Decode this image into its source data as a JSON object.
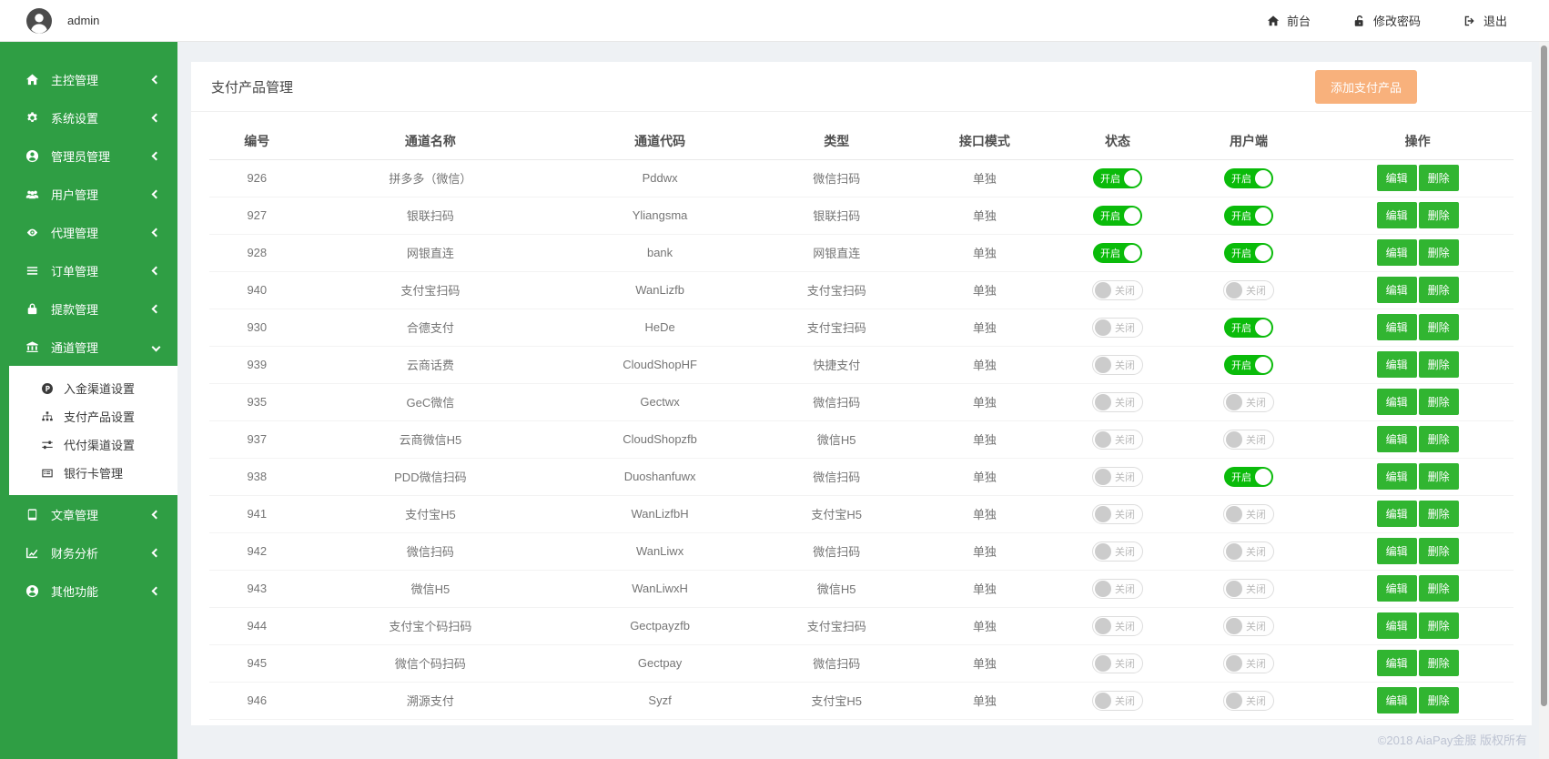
{
  "topbar": {
    "user": "admin",
    "nav": [
      {
        "icon": "home-icon",
        "label": "前台"
      },
      {
        "icon": "lock-open-icon",
        "label": "修改密码"
      },
      {
        "icon": "signout-icon",
        "label": "退出"
      }
    ]
  },
  "sidebar": {
    "items": [
      {
        "icon": "home-icon",
        "label": "主控管理",
        "expanded": false
      },
      {
        "icon": "gears-icon",
        "label": "系统设置",
        "expanded": false
      },
      {
        "icon": "user-circle-icon",
        "label": "管理员管理",
        "expanded": false
      },
      {
        "icon": "users-icon",
        "label": "用户管理",
        "expanded": false
      },
      {
        "icon": "eye-icon",
        "label": "代理管理",
        "expanded": false
      },
      {
        "icon": "list-icon",
        "label": "订单管理",
        "expanded": false
      },
      {
        "icon": "lock-icon",
        "label": "提款管理",
        "expanded": false
      },
      {
        "icon": "bank-icon",
        "label": "通道管理",
        "expanded": true,
        "children": [
          {
            "icon": "p-circle-icon",
            "label": "入金渠道设置"
          },
          {
            "icon": "sitemap-icon",
            "label": "支付产品设置"
          },
          {
            "icon": "sliders-icon",
            "label": "代付渠道设置"
          },
          {
            "icon": "list-alt-icon",
            "label": "银行卡管理"
          }
        ]
      },
      {
        "icon": "book-icon",
        "label": "文章管理",
        "expanded": false
      },
      {
        "icon": "chart-line-icon",
        "label": "财务分析",
        "expanded": false
      },
      {
        "icon": "user-circle-icon",
        "label": "其他功能",
        "expanded": false
      }
    ]
  },
  "main": {
    "card_title": "支付产品管理",
    "add_button_label": "添加支付产品",
    "table": {
      "headers": [
        "编号",
        "通道名称",
        "通道代码",
        "类型",
        "接口模式",
        "状态",
        "用户端",
        "操作"
      ],
      "toggle_on_label": "开启",
      "toggle_off_label": "关闭",
      "edit_label": "编辑",
      "delete_label": "删除",
      "rows": [
        {
          "id": "926",
          "name": "拼多多（微信）",
          "code": "Pddwx",
          "type": "微信扫码",
          "mode": "单独",
          "status": "on",
          "client": "on"
        },
        {
          "id": "927",
          "name": "银联扫码",
          "code": "Yliangsma",
          "type": "银联扫码",
          "mode": "单独",
          "status": "on",
          "client": "on"
        },
        {
          "id": "928",
          "name": "网银直连",
          "code": "bank",
          "type": "网银直连",
          "mode": "单独",
          "status": "on",
          "client": "on"
        },
        {
          "id": "940",
          "name": "支付宝扫码",
          "code": "WanLizfb",
          "type": "支付宝扫码",
          "mode": "单独",
          "status": "off",
          "client": "off"
        },
        {
          "id": "930",
          "name": "合德支付",
          "code": "HeDe",
          "type": "支付宝扫码",
          "mode": "单独",
          "status": "off",
          "client": "on"
        },
        {
          "id": "939",
          "name": "云商话费",
          "code": "CloudShopHF",
          "type": "快捷支付",
          "mode": "单独",
          "status": "off",
          "client": "on"
        },
        {
          "id": "935",
          "name": "GeC微信",
          "code": "Gectwx",
          "type": "微信扫码",
          "mode": "单独",
          "status": "off",
          "client": "off"
        },
        {
          "id": "937",
          "name": "云商微信H5",
          "code": "CloudShopzfb",
          "type": "微信H5",
          "mode": "单独",
          "status": "off",
          "client": "off"
        },
        {
          "id": "938",
          "name": "PDD微信扫码",
          "code": "Duoshanfuwx",
          "type": "微信扫码",
          "mode": "单独",
          "status": "off",
          "client": "on"
        },
        {
          "id": "941",
          "name": "支付宝H5",
          "code": "WanLizfbH",
          "type": "支付宝H5",
          "mode": "单独",
          "status": "off",
          "client": "off"
        },
        {
          "id": "942",
          "name": "微信扫码",
          "code": "WanLiwx",
          "type": "微信扫码",
          "mode": "单独",
          "status": "off",
          "client": "off"
        },
        {
          "id": "943",
          "name": "微信H5",
          "code": "WanLiwxH",
          "type": "微信H5",
          "mode": "单独",
          "status": "off",
          "client": "off"
        },
        {
          "id": "944",
          "name": "支付宝个码扫码",
          "code": "Gectpayzfb",
          "type": "支付宝扫码",
          "mode": "单独",
          "status": "off",
          "client": "off"
        },
        {
          "id": "945",
          "name": "微信个码扫码",
          "code": "Gectpay",
          "type": "微信扫码",
          "mode": "单独",
          "status": "off",
          "client": "off"
        },
        {
          "id": "946",
          "name": "溯源支付",
          "code": "Syzf",
          "type": "支付宝H5",
          "mode": "单独",
          "status": "off",
          "client": "off"
        }
      ]
    },
    "footer": "©2018 AiaPay金服 版权所有"
  },
  "colors": {
    "sidebar_green": "#2f9e44",
    "toggle_green": "#0abb0a",
    "action_button_green": "#31b531",
    "add_button_orange": "#f8b17c"
  }
}
